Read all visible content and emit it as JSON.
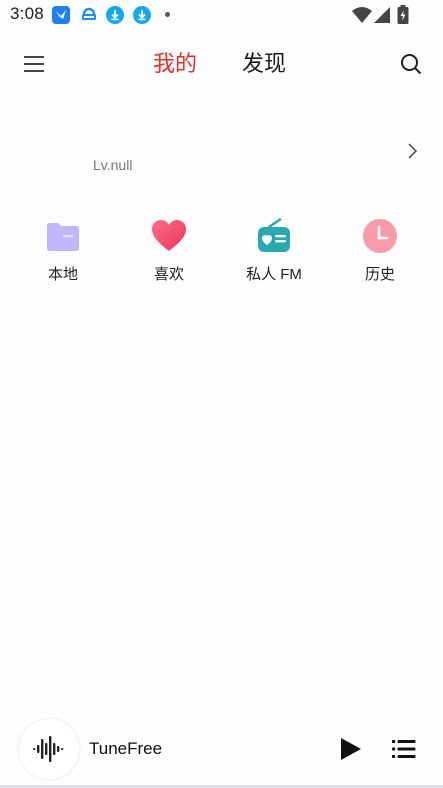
{
  "status_bar": {
    "time": "3:08",
    "notification_icons": [
      "feishu-icon",
      "download-manager-icon",
      "download-icon",
      "download-icon"
    ],
    "system_icons": [
      "wifi-icon",
      "signal-icon",
      "battery-icon"
    ]
  },
  "header": {
    "tabs": [
      {
        "label": "我的",
        "active": true
      },
      {
        "label": "发现",
        "active": false
      }
    ],
    "menu_icon": "menu-icon",
    "search_icon": "search-icon"
  },
  "profile": {
    "level": "Lv.null"
  },
  "quick_entries": [
    {
      "label": "本地",
      "icon": "folder-icon",
      "color": "#c2b5fb"
    },
    {
      "label": "喜欢",
      "icon": "heart-icon",
      "color": "#f25273"
    },
    {
      "label": "私人 FM",
      "icon": "radio-icon",
      "color": "#29a8b0"
    },
    {
      "label": "历史",
      "icon": "clock-icon",
      "color": "#f99aa8"
    }
  ],
  "player": {
    "title": "TuneFree",
    "play_icon": "play-icon",
    "playlist_icon": "playlist-icon"
  },
  "colors": {
    "accent": "#e0312a",
    "background": "#fdfcfe"
  }
}
